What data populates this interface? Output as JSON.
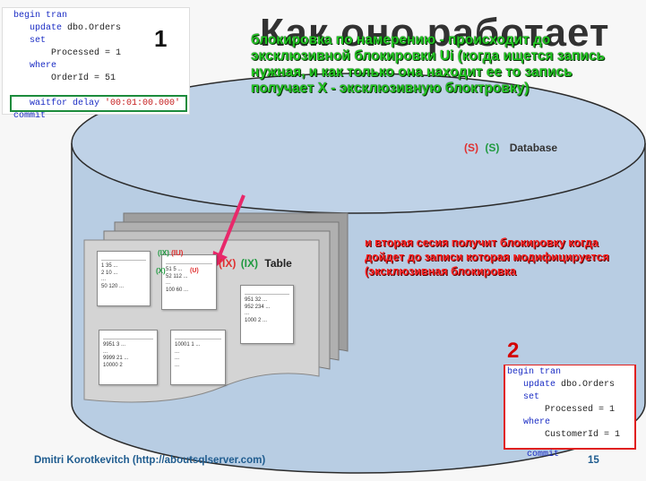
{
  "slide": {
    "title": "Как оно работает",
    "page_number": "15",
    "author": "Dmitri Korotkevitch (http://aboutsqlserver.com)"
  },
  "markers": {
    "one": "1",
    "two": "2"
  },
  "session1": {
    "lines": [
      {
        "kw": "begin tran",
        "plain": "",
        "str": ""
      },
      {
        "kw": "   update",
        "plain": " dbo.Orders",
        "str": ""
      },
      {
        "kw": "   set",
        "plain": "",
        "str": ""
      },
      {
        "kw": "",
        "plain": "       Processed = 1",
        "str": ""
      },
      {
        "kw": "   where",
        "plain": "",
        "str": ""
      },
      {
        "kw": "",
        "plain": "       OrderId = 51",
        "str": ""
      },
      {
        "kw": "",
        "plain": "",
        "str": ""
      },
      {
        "kw": "   waitfor delay",
        "plain": " ",
        "str": "'00:01:00.000'"
      },
      {
        "kw": "commit",
        "plain": "",
        "str": ""
      }
    ]
  },
  "session2": {
    "lines": [
      {
        "kw": "begin tran",
        "plain": "",
        "str": ""
      },
      {
        "kw": "   update",
        "plain": " dbo.Orders",
        "str": ""
      },
      {
        "kw": "   set",
        "plain": "",
        "str": ""
      },
      {
        "kw": "",
        "plain": "       Processed = 1",
        "str": ""
      },
      {
        "kw": "   where",
        "plain": "",
        "str": ""
      },
      {
        "kw": "",
        "plain": "       CustomerId = 1",
        "str": ""
      },
      {
        "kw": "commit",
        "plain": "",
        "str": ""
      }
    ]
  },
  "annotations": {
    "green": "блокировка по намерению - происходит до эксклюзивной блокировки Ui (когда ищется запись нужная, и как только она находит ее то запись получает X - эксклюзивную блоктровку)",
    "red": "и вторая сесия получит блокировку когда дойдет до записи которая модифицируется (эксклюзивная блокировка"
  },
  "diagram": {
    "legend_s_red": "(S)",
    "legend_s_green": "(S)",
    "database_label": "Database",
    "table_ix_red": "(IX)",
    "table_ix_green": "(IX)",
    "table_label": "Table",
    "page_ix_green": "(IX)",
    "page_iu_red": "(IU)",
    "page_x_green": "(X)",
    "page_u_red": "(U)",
    "pages": [
      {
        "rows": [
          "1 35 ...",
          "2 10 ...",
          "...",
          "50 120 ..."
        ]
      },
      {
        "rows": [
          "51 5 ...",
          "52 112 ...",
          "...",
          "100 60 ..."
        ]
      },
      {
        "rows": [
          "951 32 ...",
          "952 234 ...",
          "...",
          "1000 2 ..."
        ]
      },
      {
        "rows": [
          "9951 3 ...",
          "...",
          "9999 21 ...",
          "10000 2"
        ]
      },
      {
        "rows": [
          "10001 1 ...",
          "...",
          "...",
          "..."
        ]
      }
    ]
  },
  "colors": {
    "cylinder": "#b8cde3",
    "cylinder_edge": "#2b2b2b",
    "green_note": "#22c822",
    "red_note": "#ff2222",
    "footer": "#1f5c8f"
  }
}
